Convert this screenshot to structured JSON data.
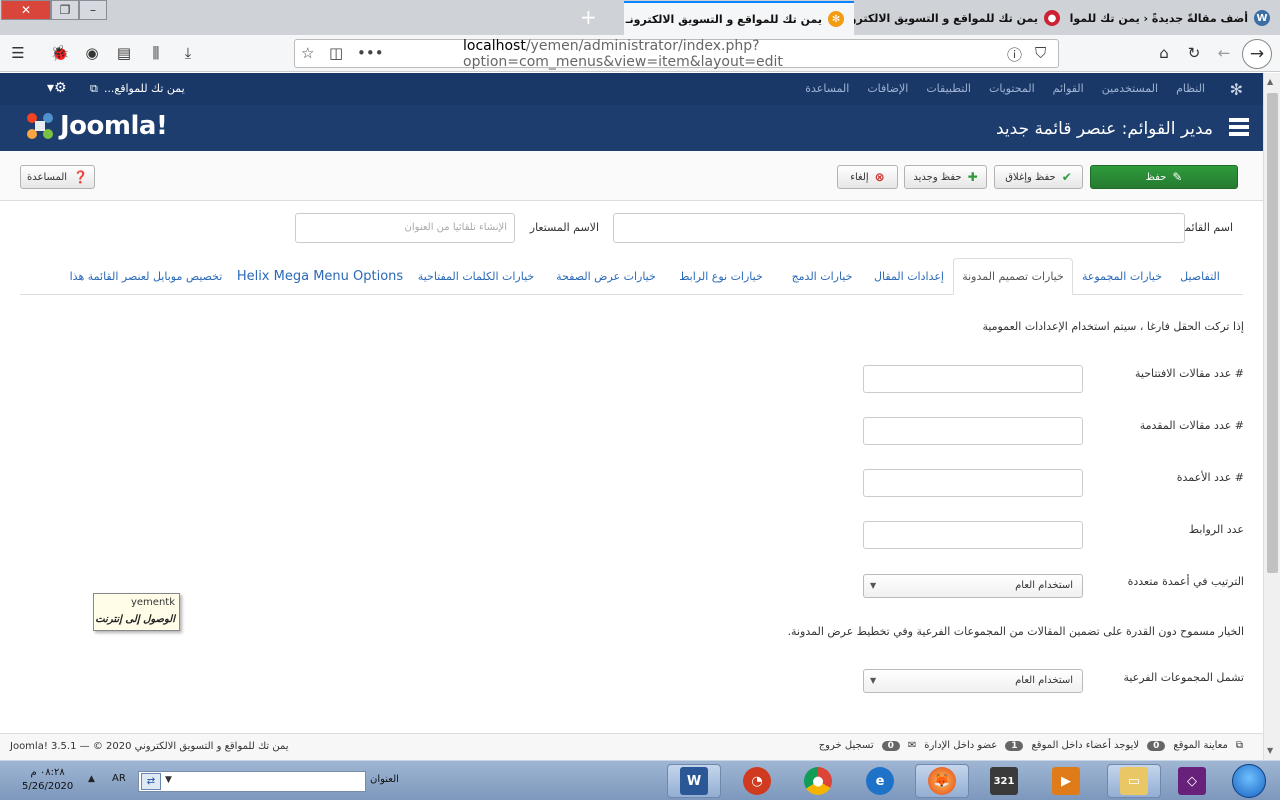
{
  "browser": {
    "tabs": [
      {
        "label": "أضف مقالةً جديدةً ‹ يمن تك للمواقع و",
        "active": false
      },
      {
        "label": "يمن تك للمواقع و التسويق الالكترونـ",
        "active": false
      },
      {
        "label": "يمن تك للمواقع و التسويق الالكترونـ",
        "active": true
      }
    ],
    "url_host": "localhost",
    "url_path": "/yemen/administrator/index.php?option=com_menus&view=item&layout=edit"
  },
  "joomla": {
    "top_menu": [
      "النظام",
      "المستخدمين",
      "القوائم",
      "المحتويات",
      "التطبيقات",
      "الإضافات",
      "المساعدة"
    ],
    "site_link": "يمن تك للمواقع...",
    "page_title": "مدير القوائم: عنصر قائمة جديد",
    "logo_text": "Joomla!",
    "toolbar": {
      "save": "حفظ",
      "save_close": "حفظ وإغلاق",
      "save_new": "حفظ وجديد",
      "cancel": "إلغاء",
      "help": "المساعدة"
    },
    "form": {
      "menu_title_label": "اسم القائمة *",
      "alias_label": "الاسم المستعار",
      "alias_placeholder": "الإنشاء تلقائيا من العنوان",
      "tabs": [
        "التفاصيل",
        "خيارات المجموعة",
        "خيارات تصميم المدونة",
        "إعدادات المقال",
        "خيارات الدمج",
        "خيارات نوع الرابط",
        "خيارات عرض الصفحة",
        "خيارات الكلمات المفتاحية",
        "Helix Mega Menu Options",
        "تخصيص موبايل لعنصر القائمة هذا"
      ],
      "hint": "إذا تركت الحقل فارغا ، سيتم استخدام الإعدادات العمومية",
      "leading_label": "# عدد مقالات الافتتاحية",
      "intro_label": "# عدد مقالات المقدمة",
      "columns_label": "# عدد الأعمدة",
      "links_label": "عدد الروابط",
      "multi_col_label": "الترتيب في أعمدة متعددة",
      "multi_col_value": "استخدام العام",
      "sub_note": "الخيار مسموح دون القدرة على تضمين المقالات من المجموعات الفرعية وفي تخطيط عرض المدونة.",
      "include_sub_label": "تشمل المجموعات الفرعية",
      "include_sub_value": "استخدام العام"
    },
    "tooltip": {
      "line1": "yementk",
      "line2": "الوصول إلى إنترنت"
    },
    "status": {
      "preview": "معاينة الموقع",
      "visitors_count": "0",
      "visitors_text": "لايوجد أعضاء داخل الموقع",
      "admins_count": "1",
      "admins_text": "عضو داخل الإدارة",
      "messages_count": "0",
      "logout": "تسجيل خروج",
      "footer": "يمن تك للمواقع و التسويق الالكتروني Joomla! 3.5.1 — © 2020"
    }
  },
  "taskbar": {
    "time": "٠٨:٢٨ م",
    "date": "5/26/2020",
    "lang": "AR",
    "address_label": "العنوان",
    "address_value": ""
  }
}
